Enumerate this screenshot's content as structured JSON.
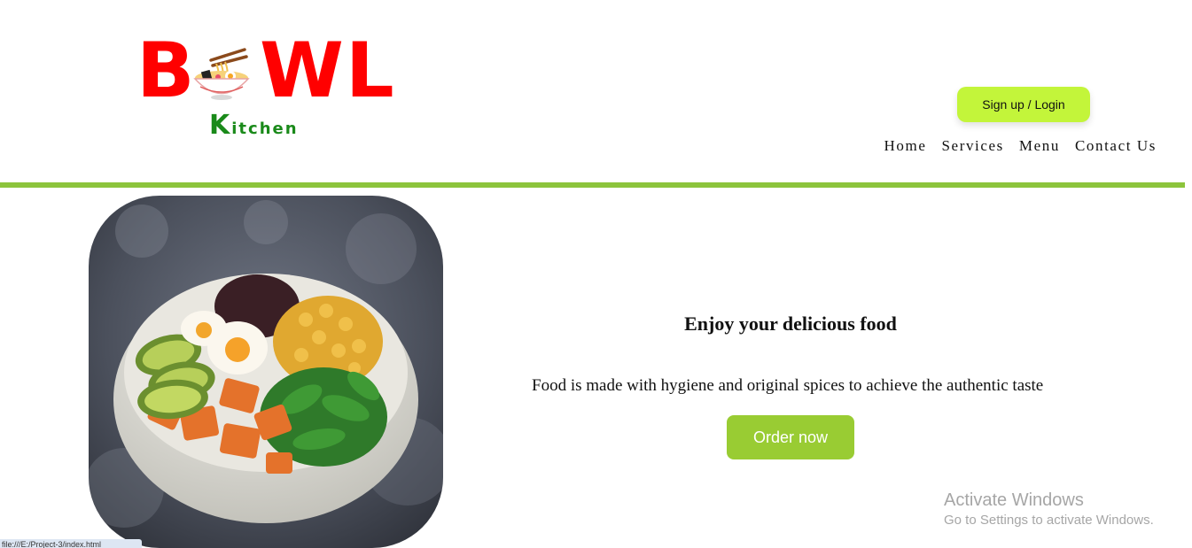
{
  "header": {
    "logo": {
      "word_left": "B",
      "word_right": "WL",
      "sub_first": "K",
      "sub_rest": "itchen"
    },
    "signup_label": "Sign up / Login",
    "nav": {
      "home": "Home",
      "services": "Services",
      "menu": "Menu",
      "contact": "Contact Us"
    }
  },
  "hero": {
    "title": "Enjoy your delicious food",
    "description": "Food is made with hygiene and original spices to achieve the authentic taste",
    "order_label": "Order now"
  },
  "os_overlay": {
    "activate_title": "Activate Windows",
    "activate_sub": "Go to Settings to activate Windows."
  },
  "status_bar": {
    "url": "file:///E:/Project-3/index.html"
  },
  "colors": {
    "brand_red": "#ff0000",
    "brand_green": "#1a8a1a",
    "signup_bg": "#c3f53a",
    "divider": "#8cc43c",
    "order_bg": "#99cc33"
  }
}
